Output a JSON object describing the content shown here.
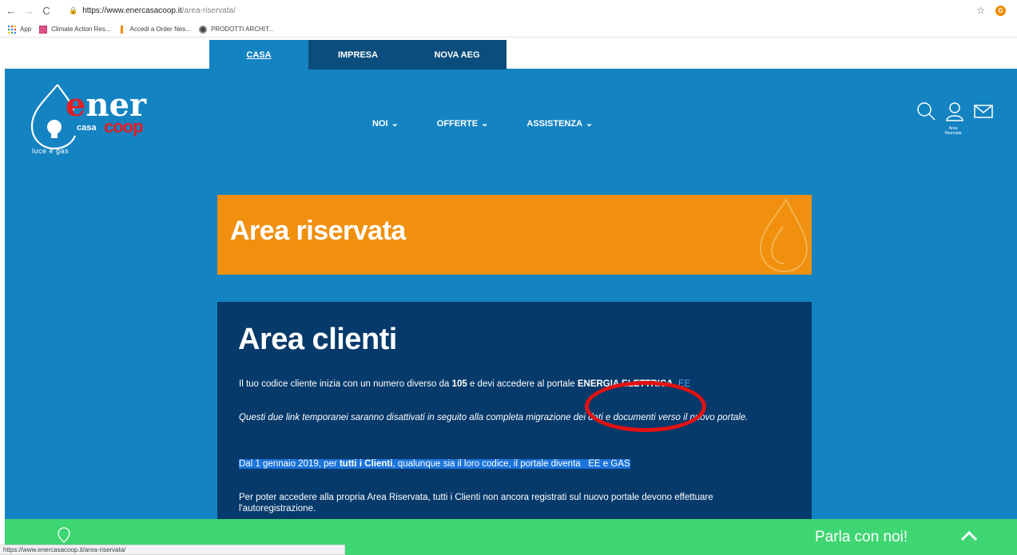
{
  "browser": {
    "url_host": "https://www.enercasacoop.it",
    "url_path": "/area-riservata/",
    "bookmarks": [
      "App",
      "Climate Action Res...",
      "Accedi a Order Nes...",
      "PRODOTTI ARCHIT..."
    ],
    "profile_initial": "G",
    "status_url": "https://www.enercasacoop.it/area-riservata/"
  },
  "segments": [
    "CASA",
    "IMPRESA",
    "NOVA AEG"
  ],
  "logo": {
    "word": "ener",
    "sub": "casa",
    "brand": "coop",
    "tagline": "luce e gas"
  },
  "nav": [
    "NOI",
    "OFFERTE",
    "ASSISTENZA"
  ],
  "header_icons": {
    "area_label_line1": "Area",
    "area_label_line2": "Riservata"
  },
  "banner": {
    "title": "Area riservata"
  },
  "card": {
    "title": "Area clienti",
    "p1_a": "Il tuo codice cliente inizia con un numero diverso da ",
    "p1_b": "105",
    "p1_c": " e devi accedere al portale ",
    "p1_d": "ENERGIA ELETTRICA",
    "p1_link": "EE",
    "p2": "Questi due link temporanei saranno disattivati in seguito alla completa migrazione dei dati e documenti verso il nuovo portale.",
    "p3_a": "Dal 1 gennaio 2019, per ",
    "p3_b": "tutti i Clienti",
    "p3_c": ", qualunque sia il loro codice, il portale diventa ",
    "p3_link": "EE e GAS",
    "p4": "Per poter accedere alla propria Area Riservata, tutti i Clienti non ancora registrati sul nuovo portale devono effettuare l'autoregistrazione."
  },
  "footer": {
    "chat_label": "Parla con noi!"
  },
  "colors": {
    "page_blue": "#1483c2",
    "tab_dark": "#0b4d7c",
    "banner_orange": "#f0900e",
    "card_navy": "#063a6b",
    "footer_green": "#3ed672",
    "annotation_red": "#e21212"
  }
}
